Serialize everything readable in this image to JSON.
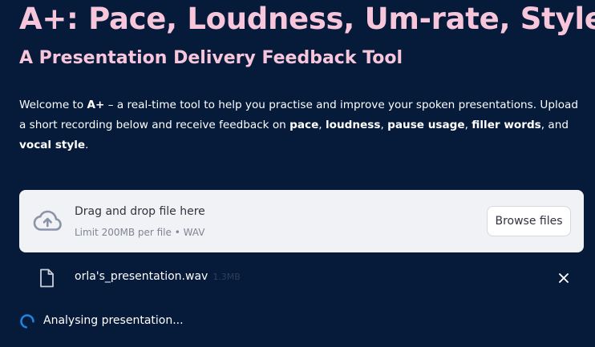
{
  "header": {
    "title": "A+: Pace, Loudness, Um-rate, Style",
    "subtitle": "A Presentation Delivery Feedback Tool"
  },
  "intro": {
    "p1": "Welcome to ",
    "brand": "A+",
    "p2": " – a real-time tool to help you practise and improve your spoken presentations. Upload a short recording below and receive feedback on ",
    "k1": "pace",
    "s1": ", ",
    "k2": "loudness",
    "s2": ", ",
    "k3": "pause usage",
    "s3": ", ",
    "k4": "filler words",
    "s4": ", and ",
    "k5": "vocal style",
    "end": "."
  },
  "uploader": {
    "title": "Drag and drop file here",
    "limits": "Limit 200MB per file • WAV",
    "browse_label": "Browse files"
  },
  "file": {
    "name": "orla's_presentation.wav",
    "size": "1.3MB"
  },
  "status": {
    "text": "Analysing presentation..."
  },
  "colors": {
    "background": "#061a3a",
    "title": "#f7c6da",
    "dropzone": "#f0f2f6",
    "spinner": "#1c83e1"
  },
  "icons": {
    "upload": "cloud-upload-icon",
    "file": "file-icon",
    "remove": "close-icon",
    "spinner": "spinner-icon"
  }
}
